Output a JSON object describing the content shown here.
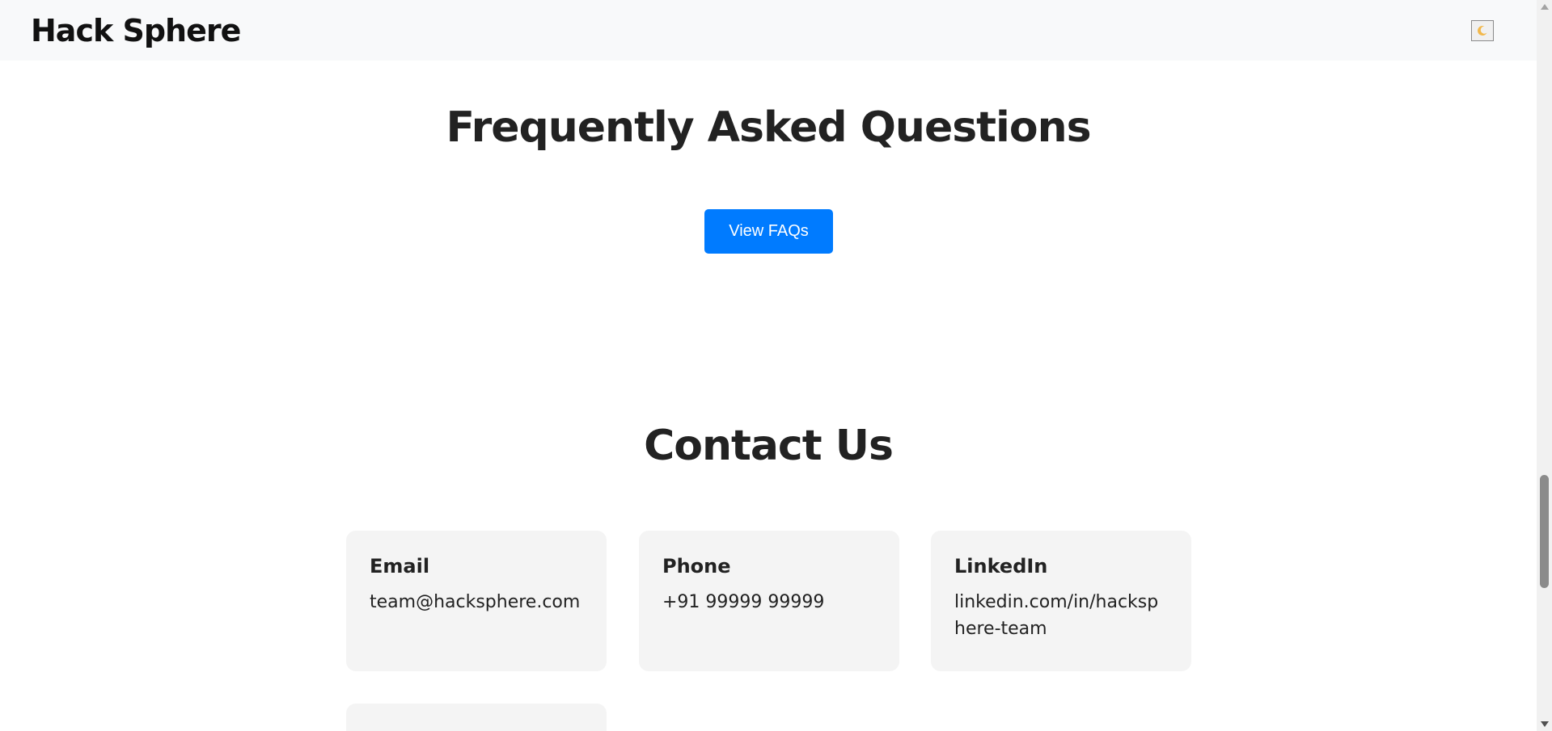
{
  "header": {
    "brand": "Hack Sphere",
    "theme_toggle_icon": "moon-icon"
  },
  "faq": {
    "title": "Frequently Asked Questions",
    "button_label": "View FAQs"
  },
  "contact": {
    "title": "Contact Us",
    "cards": [
      {
        "label": "Email",
        "value": "team@hacksphere.com"
      },
      {
        "label": "Phone",
        "value": "+91 99999 99999"
      },
      {
        "label": "LinkedIn",
        "value": "linkedin.com/in/hacksphere-team"
      }
    ]
  },
  "colors": {
    "accent": "#007bff",
    "header_bg": "#f8f9fa",
    "card_bg": "#f4f4f4",
    "text": "#222222"
  }
}
